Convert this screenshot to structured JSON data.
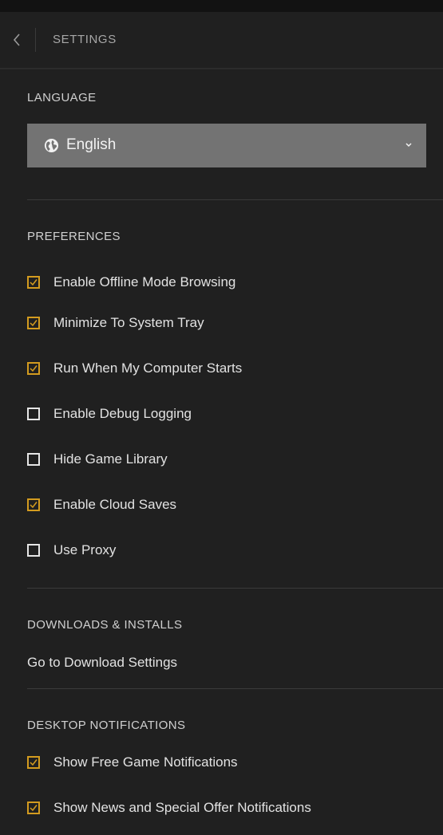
{
  "header": {
    "title": "SETTINGS"
  },
  "language": {
    "section_title": "LANGUAGE",
    "selected": "English"
  },
  "preferences": {
    "section_title": "PREFERENCES",
    "items": [
      {
        "label": "Enable Offline Mode Browsing",
        "checked": true
      },
      {
        "label": "Minimize To System Tray",
        "checked": true
      },
      {
        "label": "Run When My Computer Starts",
        "checked": true
      },
      {
        "label": "Enable Debug Logging",
        "checked": false
      },
      {
        "label": "Hide Game Library",
        "checked": false
      },
      {
        "label": "Enable Cloud Saves",
        "checked": true
      },
      {
        "label": "Use Proxy",
        "checked": false
      }
    ]
  },
  "downloads": {
    "section_title": "DOWNLOADS & INSTALLS",
    "link_label": "Go to Download Settings"
  },
  "notifications": {
    "section_title": "DESKTOP NOTIFICATIONS",
    "items": [
      {
        "label": "Show Free Game Notifications",
        "checked": true
      },
      {
        "label": "Show News and Special Offer Notifications",
        "checked": true
      }
    ]
  },
  "colors": {
    "accent": "#d39b1f",
    "background": "#202020",
    "select_bg": "#737373"
  },
  "icons": {
    "back": "chevron-left-icon",
    "globe": "globe-icon",
    "dropdown": "chevron-down-icon",
    "check": "checkmark-icon"
  }
}
